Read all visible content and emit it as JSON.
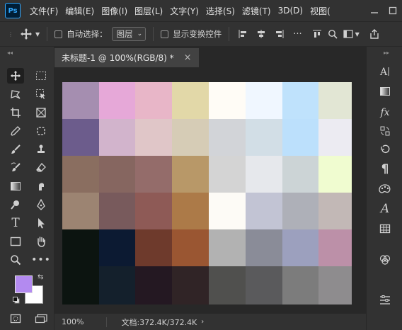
{
  "app": {
    "logo": "Ps"
  },
  "menu": [
    "文件(F)",
    "编辑(E)",
    "图像(I)",
    "图层(L)",
    "文字(Y)",
    "选择(S)",
    "滤镜(T)",
    "3D(D)",
    "视图("
  ],
  "window_controls": [
    "minimize-icon",
    "maximize-icon"
  ],
  "options_bar": {
    "auto_select_label": "自动选择：",
    "auto_select_target": "图层",
    "show_transform_label": "显示变换控件"
  },
  "document": {
    "tab_title": "未标题-1 @ 100%(RGB/8) *",
    "close_glyph": "×",
    "zoom": "100%",
    "doc_info": "文档:372.4K/372.4K"
  },
  "colors": {
    "foreground": "#b38af0",
    "background": "#ffffff",
    "swatches": [
      [
        "#a58eb0",
        "#e6a8d8",
        "#e8b6c8",
        "#e2d8a8",
        "#fffcf6",
        "#f0f7ff",
        "#bfe2fc",
        "#e2e6d4"
      ],
      [
        "#6c5c8c",
        "#d2b4cc",
        "#e0c6c8",
        "#d6ccb6",
        "#d2d4d8",
        "#d2dee6",
        "#bce0fc",
        "#ecebf2"
      ],
      [
        "#8a6e60",
        "#866660",
        "#946c6a",
        "#b89868",
        "#d4d4d4",
        "#e6e8ec",
        "#ccd4d6",
        "#f0fcd0"
      ],
      [
        "#9c8472",
        "#785a5c",
        "#8e5a56",
        "#ac7a48",
        "#fdfbf6",
        "#c2c4d4",
        "#aeb0b8",
        "#c2b8b6"
      ],
      [
        "#0c1410",
        "#0c1a32",
        "#6e3a2c",
        "#9a5632",
        "#b2b2b2",
        "#8a8c98",
        "#9ca0be",
        "#bc90a8"
      ],
      [
        "#0c1410",
        "#14202c",
        "#241822",
        "#302426",
        "#50504e",
        "#5a5a5c",
        "#7c7c7c",
        "#8e8c8e"
      ]
    ]
  },
  "tools_left": [
    [
      "move-tool-icon",
      "rect-marquee-icon"
    ],
    [
      "lasso-icon",
      "object-select-icon"
    ],
    [
      "crop-icon",
      "frame-icon"
    ],
    [
      "eyedropper-icon",
      "spot-heal-icon"
    ],
    [
      "brush-icon",
      "clone-stamp-icon"
    ],
    [
      "history-brush-icon",
      "eraser-icon"
    ],
    [
      "gradient-icon",
      "smudge-icon"
    ],
    [
      "dodge-icon",
      "pen-icon"
    ],
    [
      "type-tool-icon",
      "path-select-icon"
    ],
    [
      "rectangle-icon",
      "hand-icon"
    ],
    [
      "zoom-icon",
      "more-tools-icon"
    ]
  ],
  "tools_right": [
    "character-panel-icon",
    "gradient-panel-icon",
    "fx-panel-icon",
    "actions-panel-icon",
    "history-panel-icon",
    "paragraph-panel-icon",
    "color-panel-icon",
    "glyphs-panel-icon",
    "table-panel-icon",
    "channels-panel-icon",
    "layer-props-icon"
  ]
}
